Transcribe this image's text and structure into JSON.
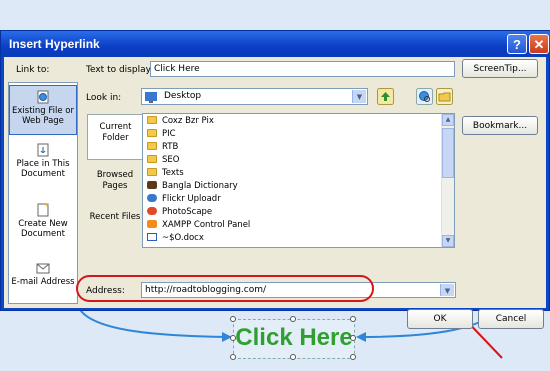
{
  "window": {
    "title": "Insert Hyperlink",
    "help_glyph": "?",
    "close_glyph": "✕"
  },
  "link_to": {
    "label": "Link to:",
    "items": [
      {
        "label": "Existing File or Web Page",
        "icon": "globe-page-icon"
      },
      {
        "label": "Place in This Document",
        "icon": "document-anchor-icon"
      },
      {
        "label": "Create New Document",
        "icon": "new-document-icon"
      },
      {
        "label": "E-mail Address",
        "icon": "mail-icon"
      }
    ]
  },
  "text_to_display": {
    "label": "Text to display:",
    "value": "Click Here"
  },
  "screentip_button": "ScreenTip...",
  "look_in": {
    "label": "Look in:",
    "value": "Desktop"
  },
  "bookmark_button": "Bookmark...",
  "side_tabs": [
    {
      "label": "Current Folder"
    },
    {
      "label": "Browsed Pages"
    },
    {
      "label": "Recent Files"
    }
  ],
  "files": [
    {
      "name": "Coxz Bzr Pix",
      "icon": "folder-icon"
    },
    {
      "name": "PIC",
      "icon": "folder-icon"
    },
    {
      "name": "RTB",
      "icon": "folder-icon"
    },
    {
      "name": "SEO",
      "icon": "folder-icon"
    },
    {
      "name": "Texts",
      "icon": "folder-icon"
    },
    {
      "name": "Bangla Dictionary",
      "icon": "app-icon"
    },
    {
      "name": "Flickr Uploadr",
      "icon": "app-icon"
    },
    {
      "name": "PhotoScape",
      "icon": "app-icon"
    },
    {
      "name": "XAMPP Control Panel",
      "icon": "app-icon"
    },
    {
      "name": "~$O.docx",
      "icon": "word-doc-icon"
    }
  ],
  "address": {
    "label": "Address:",
    "value": "http://roadtoblogging.com/"
  },
  "ok_button": "OK",
  "cancel_button": "Cancel",
  "document_link_text": "Click Here",
  "colors": {
    "annotation": "#d4161b",
    "link_text": "#2fa02f",
    "connector": "#2f86d8"
  }
}
